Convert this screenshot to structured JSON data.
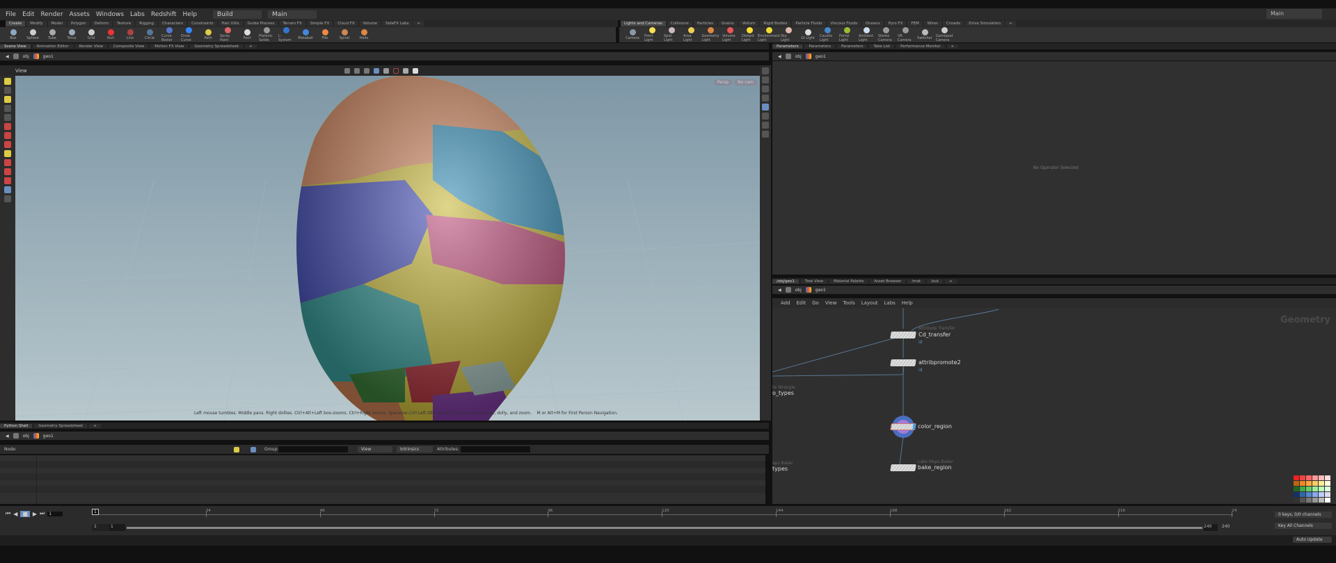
{
  "menu": {
    "items": [
      "File",
      "Edit",
      "Render",
      "Assets",
      "Windows",
      "Labs",
      "Redshift",
      "Help"
    ],
    "desktop": "Build",
    "context": "Main",
    "right_desktop": "Main"
  },
  "shelf_left": {
    "tabs": [
      "Create",
      "Modify",
      "Model",
      "Polygon",
      "Deform",
      "Texture",
      "Rigging",
      "Characters",
      "Constraints",
      "Hair Utils",
      "Guide Process",
      "Terrain FX",
      "Simple FX",
      "Cloud FX",
      "Volume",
      "SideFX Labs"
    ],
    "tools": [
      {
        "label": "Box",
        "color": "#8fa6bd"
      },
      {
        "label": "Sphere",
        "color": "#ccc"
      },
      {
        "label": "Tube",
        "color": "#aaa"
      },
      {
        "label": "Torus",
        "color": "#9ab"
      },
      {
        "label": "Grid",
        "color": "#ccc"
      },
      {
        "label": "Null",
        "color": "#e33"
      },
      {
        "label": "Line",
        "color": "#a44"
      },
      {
        "label": "Circle",
        "color": "#579"
      },
      {
        "label": "Curve Bezier",
        "color": "#57c"
      },
      {
        "label": "Draw Curve",
        "color": "#38f"
      },
      {
        "label": "Path",
        "color": "#dc4"
      },
      {
        "label": "Spray Paint",
        "color": "#d66"
      },
      {
        "label": "Font",
        "color": "#ddd"
      },
      {
        "label": "Platonic Solids",
        "color": "#999"
      },
      {
        "label": "L-System",
        "color": "#37c"
      },
      {
        "label": "Metaball",
        "color": "#48d"
      },
      {
        "label": "File",
        "color": "#e84"
      },
      {
        "label": "Spiral",
        "color": "#c85"
      },
      {
        "label": "Helix",
        "color": "#d84"
      }
    ]
  },
  "shelf_right": {
    "tabs": [
      "Lights and Cameras",
      "Collisions",
      "Particles",
      "Grains",
      "Vellum",
      "Rigid Bodies",
      "Particle Fluids",
      "Viscous Fluids",
      "Oceans",
      "Pyro FX",
      "FEM",
      "Wires",
      "Crowds",
      "Drive Simulation"
    ],
    "tools": [
      {
        "label": "Camera",
        "color": "#89a"
      },
      {
        "label": "Point Light",
        "color": "#fd5"
      },
      {
        "label": "Spot Light",
        "color": "#cbb"
      },
      {
        "label": "Area Light",
        "color": "#ec5"
      },
      {
        "label": "Geometry Light",
        "color": "#d84"
      },
      {
        "label": "Volume Light",
        "color": "#e55"
      },
      {
        "label": "Distant Light",
        "color": "#fd3"
      },
      {
        "label": "Environment Light",
        "color": "#ed3"
      },
      {
        "label": "Sky Light",
        "color": "#dba"
      },
      {
        "label": "GI Light",
        "color": "#ddd"
      },
      {
        "label": "Caustic Light",
        "color": "#48c"
      },
      {
        "label": "Portal Light",
        "color": "#9b3"
      },
      {
        "label": "Ambient Light",
        "color": "#cde"
      },
      {
        "label": "Stereo Camera",
        "color": "#999"
      },
      {
        "label": "VR Camera",
        "color": "#999"
      },
      {
        "label": "Switcher",
        "color": "#bbb"
      },
      {
        "label": "Gamepad Camera",
        "color": "#ccc"
      }
    ]
  },
  "left_panetabs": [
    "Scene View",
    "Animation Editor",
    "Render View",
    "Composite View",
    "Motion FX View",
    "Geometry Spreadsheet"
  ],
  "right_panetabs": [
    "Parameters",
    "Parameters",
    "Parameters",
    "Take List",
    "Performance Monitor"
  ],
  "path": {
    "root": "obj",
    "node": "geo1"
  },
  "viewport": {
    "label": "View",
    "persp": "Persp",
    "cam": "No cam",
    "hint": "Left mouse tumbles. Middle pans. Right dollies. Ctrl+Alt+Left box-zooms. Ctrl+Right zooms. Spacebar-Ctrl-Left tilts. Hold L for alternate tumble, dolly, and zoom.    M or Alt+M for First Person Navigation."
  },
  "params": {
    "empty": "No Operator Selected"
  },
  "bottom_tabs": [
    "Python Shell",
    "Geometry Spreadsheet"
  ],
  "spreadsheet": {
    "node_label": "Node:",
    "group_label": "Group:",
    "view": "View",
    "intrinsics": "Intrinsics",
    "attributes_label": "Attributes:"
  },
  "network": {
    "tabs": [
      "/obj/geo1",
      "Tree View",
      "Material Palette",
      "Asset Browser",
      "/mat",
      "/out"
    ],
    "menu": [
      "Add",
      "Edit",
      "Go",
      "View",
      "Tools",
      "Layout",
      "Labs",
      "Help"
    ],
    "context_label": "Geometry",
    "nodes": [
      {
        "type": "Attribute Transfer",
        "name": "Cd_transfer",
        "flag": "id"
      },
      {
        "type": "",
        "name": "attribpromote2",
        "flag": "id"
      },
      {
        "type": "",
        "name": "color_region",
        "flag": ""
      },
      {
        "type": "Labs Maps Baker",
        "name": "bake_region",
        "flag": ""
      }
    ],
    "partial": [
      {
        "type": "te Wrangle",
        "name": "o_types"
      },
      {
        "type": "aps Baker",
        "name": "types"
      }
    ]
  },
  "timeline": {
    "frame": "1",
    "ticks": [
      "24",
      "48",
      "72",
      "96",
      "120",
      "144",
      "168",
      "192",
      "216",
      "24"
    ],
    "start": "1",
    "start2": "1",
    "end": "240",
    "end2": "240",
    "keys": "0 keys, 0/0 channels",
    "key_all": "Key All Channels",
    "auto_update": "Auto Update"
  }
}
